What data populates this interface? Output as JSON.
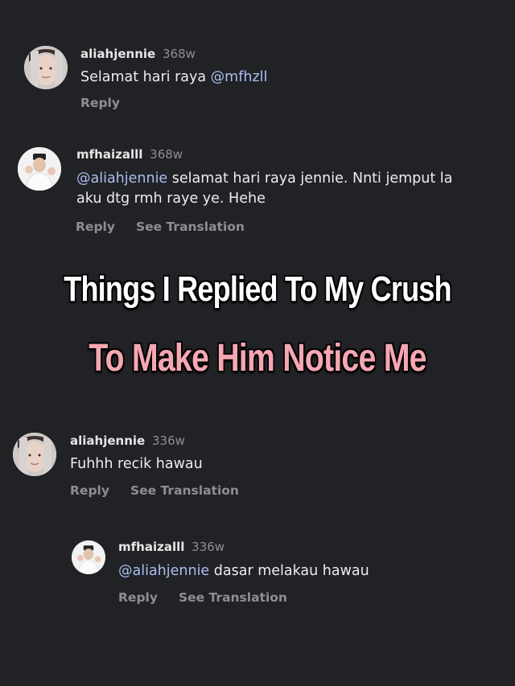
{
  "comments": [
    {
      "username": "aliahjennie",
      "age": "368w",
      "text": "Selamat hari raya ",
      "mention": "@mfhzll",
      "reply_label": "Reply"
    },
    {
      "username": "mfhaizalll",
      "age": "368w",
      "mention": "@aliahjennie",
      "line1": " selamat hari raya jennie. Nnti jemput la",
      "line2": "aku dtg rmh raye ye. Hehe",
      "reply_label": "Reply",
      "translate_label": "See Translation"
    },
    {
      "username": "aliahjennie",
      "age": "336w",
      "text": "Fuhhh recik hawau",
      "reply_label": "Reply",
      "translate_label": "See Translation"
    },
    {
      "username": "mfhaizalll",
      "age": "336w",
      "mention": "@aliahjennie",
      "text": " dasar melakau hawau",
      "reply_label": "Reply",
      "translate_label": "See Translation"
    }
  ],
  "overlay": {
    "line1": "Things I Replied To My Crush",
    "line2": "To Make Him Notice Me",
    "line1_color": "#ffffff",
    "line2_color": "#f5a7b2"
  },
  "colors": {
    "background": "#212226",
    "mention": "#a8bff0",
    "muted": "#8e8f93"
  }
}
